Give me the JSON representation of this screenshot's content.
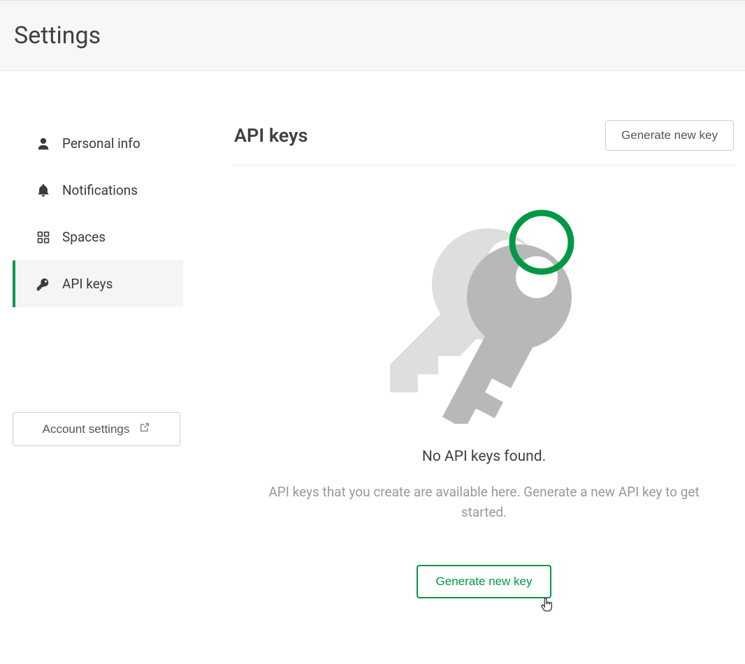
{
  "header": {
    "title": "Settings"
  },
  "sidebar": {
    "items": [
      {
        "label": "Personal info",
        "icon": "person"
      },
      {
        "label": "Notifications",
        "icon": "bell"
      },
      {
        "label": "Spaces",
        "icon": "grid"
      },
      {
        "label": "API keys",
        "icon": "key"
      }
    ],
    "account_settings_label": "Account settings"
  },
  "main": {
    "title": "API keys",
    "generate_button_top": "Generate new key",
    "empty_state": {
      "title": "No API keys found.",
      "description": "API keys that you create are available here. Generate a new API key to get started.",
      "generate_button": "Generate new key"
    }
  }
}
